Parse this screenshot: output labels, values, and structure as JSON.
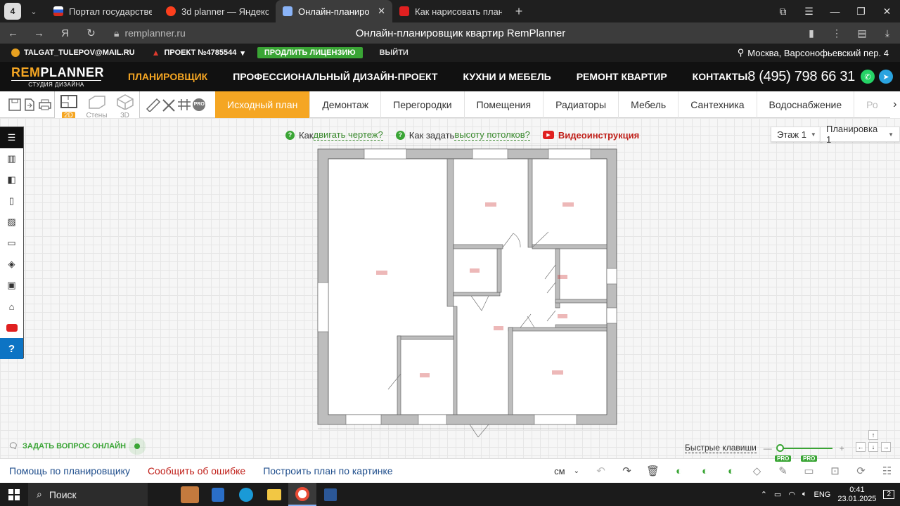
{
  "browser": {
    "tab_counter": "4",
    "tabs": [
      {
        "label": "Портал государственных",
        "color": "#d52b1e",
        "active": false
      },
      {
        "label": "3d planner — Яндекс: наш",
        "color": "#fc3f1d",
        "active": false
      },
      {
        "label": "Онлайн-планировщик",
        "color": "#8ab4f8",
        "active": true
      },
      {
        "label": "Как нарисовать план в пр",
        "color": "#e02020",
        "active": false
      }
    ],
    "url": "remplanner.ru",
    "page_title": "Онлайн-планировщик квартир RemPlanner"
  },
  "sitebar": {
    "user_email": "TALGAT_TULEPOV@MAIL.RU",
    "project": "ПРОЕКТ №4785544",
    "license_button": "ПРОДЛИТЬ ЛИЦЕНЗИЮ",
    "logout": "ВЫЙТИ",
    "address": "Москва, Варсонофьевский пер. 4"
  },
  "header": {
    "logo_main_a": "REM",
    "logo_main_b": "PLANNER",
    "logo_sub": "СТУДИЯ ДИЗАЙНА",
    "nav": [
      "ПЛАНИРОВЩИК",
      "ПРОФЕССИОНАЛЬНЫЙ ДИЗАЙН-ПРОЕКТ",
      "КУХНИ И МЕБЕЛЬ",
      "РЕМОНТ КВАРТИР",
      "КОНТАКТЫ"
    ],
    "phone": "8 (495) 798 66 31"
  },
  "toolbar": {
    "view_modes": [
      "2D",
      "Стены",
      "3D"
    ],
    "pro_label": "PRO",
    "steps": [
      "Исходный план",
      "Демонтаж",
      "Перегородки",
      "Помещения",
      "Радиаторы",
      "Мебель",
      "Сантехника",
      "Водоснабжение",
      "Ро"
    ]
  },
  "canvas": {
    "help_1_prefix": "Как ",
    "help_1_link": "двигать чертеж?",
    "help_2_prefix": "Как задать ",
    "help_2_link": "высоту потолков?",
    "video_label": "Видеоинструкция",
    "floor_label": "Этаж 1",
    "layout_label": "Планировка 1",
    "ask_label": "ЗАДАТЬ ВОПРОС ОНЛАЙН",
    "hotkeys_label": "Быстрые клавиши",
    "zoom_level": 0.0
  },
  "bottombar": {
    "help_link": "Помощь по планировщику",
    "report_link": "Сообщить об ошибке",
    "build_link": "Построить план по картинке",
    "unit": "см",
    "pro_label": "PRO"
  },
  "taskbar": {
    "search_label": "Поиск",
    "lang": "ENG",
    "time": "0:41",
    "date": "23.01.2025",
    "notifications": "2"
  },
  "colors": {
    "accent": "#f5a623",
    "green": "#3aa535",
    "red": "#c0201a",
    "blue": "#1f4e8c"
  }
}
